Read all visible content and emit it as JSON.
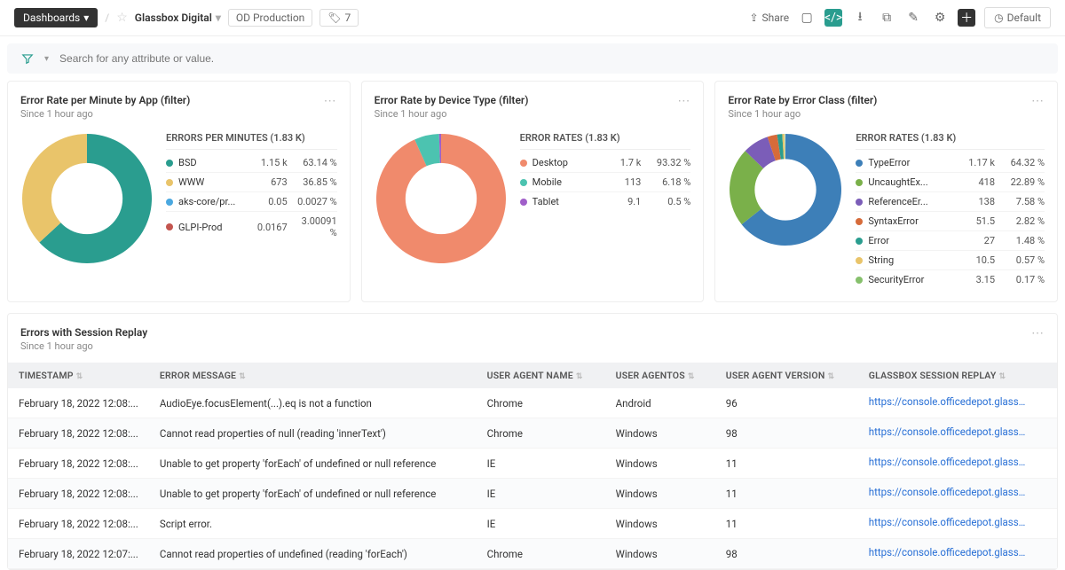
{
  "topbar": {
    "dashboards_label": "Dashboards",
    "title": "Glassbox Digital",
    "environment": "OD Production",
    "tag_count": "7",
    "share_label": "Share",
    "default_label": "Default"
  },
  "filter": {
    "placeholder": "Search for any attribute or value."
  },
  "cards": [
    {
      "id": "app",
      "title": "Error Rate per Minute by App (filter)",
      "subtitle": "Since 1 hour ago",
      "legend_header": "ERRORS PER MINUTES (1.83 K)",
      "items": [
        {
          "name": "BSD",
          "val": "1.15 k",
          "pct": "63.14 %",
          "color": "#2a9d8f"
        },
        {
          "name": "WWW",
          "val": "673",
          "pct": "36.85 %",
          "color": "#e9c46a"
        },
        {
          "name": "aks-core/pr...",
          "val": "0.05",
          "pct": "0.0027 %",
          "color": "#4aa8e0"
        },
        {
          "name": "GLPI-Prod",
          "val": "0.0167",
          "pct": "3.00091 %",
          "color": "#c3554f"
        }
      ],
      "donut": [
        {
          "pct": 63.14,
          "color": "#2a9d8f"
        },
        {
          "pct": 36.85,
          "color": "#e9c46a"
        },
        {
          "pct": 0.01,
          "color": "#4aa8e0"
        }
      ]
    },
    {
      "id": "device",
      "title": "Error Rate by Device Type (filter)",
      "subtitle": "Since 1 hour ago",
      "legend_header": "ERROR RATES (1.83 K)",
      "items": [
        {
          "name": "Desktop",
          "val": "1.7 k",
          "pct": "93.32 %",
          "color": "#f08a6c"
        },
        {
          "name": "Mobile",
          "val": "113",
          "pct": "6.18 %",
          "color": "#4cc3b0"
        },
        {
          "name": "Tablet",
          "val": "9.1",
          "pct": "0.5 %",
          "color": "#a05fc9"
        }
      ],
      "donut": [
        {
          "pct": 93.32,
          "color": "#f08a6c"
        },
        {
          "pct": 6.18,
          "color": "#4cc3b0"
        },
        {
          "pct": 0.5,
          "color": "#a05fc9"
        }
      ]
    },
    {
      "id": "class",
      "title": "Error Rate by Error Class (filter)",
      "subtitle": "Since 1 hour ago",
      "legend_header": "ERROR RATES (1.83 K)",
      "items": [
        {
          "name": "TypeError",
          "val": "1.17 k",
          "pct": "64.32 %",
          "color": "#3d7fb8"
        },
        {
          "name": "UncaughtEx...",
          "val": "418",
          "pct": "22.89 %",
          "color": "#7ab04a"
        },
        {
          "name": "ReferenceEr...",
          "val": "138",
          "pct": "7.58 %",
          "color": "#7b5db8"
        },
        {
          "name": "SyntaxError",
          "val": "51.5",
          "pct": "2.82 %",
          "color": "#d66b3a"
        },
        {
          "name": "Error",
          "val": "27",
          "pct": "1.48 %",
          "color": "#2a9d8f"
        },
        {
          "name": "String",
          "val": "10.5",
          "pct": "0.57 %",
          "color": "#e9c46a"
        },
        {
          "name": "SecurityError",
          "val": "3.15",
          "pct": "0.17 %",
          "color": "#86c06c"
        }
      ],
      "donut": [
        {
          "pct": 64.32,
          "color": "#3d7fb8"
        },
        {
          "pct": 22.89,
          "color": "#7ab04a"
        },
        {
          "pct": 7.58,
          "color": "#7b5db8"
        },
        {
          "pct": 2.82,
          "color": "#d66b3a"
        },
        {
          "pct": 1.48,
          "color": "#2a9d8f"
        },
        {
          "pct": 0.57,
          "color": "#e9c46a"
        },
        {
          "pct": 0.17,
          "color": "#86c06c"
        }
      ]
    }
  ],
  "errors_table": {
    "title": "Errors with Session Replay",
    "subtitle": "Since 1 hour ago",
    "columns": {
      "timestamp": "TIMESTAMP",
      "message": "ERROR MESSAGE",
      "ua_name": "USER AGENT NAME",
      "ua_os": "USER AGENTOS",
      "ua_ver": "USER AGENT VERSION",
      "replay": "GLASSBOX SESSION REPLAY"
    },
    "rows": [
      {
        "ts": "February 18, 2022 12:08:...",
        "msg": "AudioEye.focusElement(...).eq is not a function",
        "ua": "Chrome",
        "os": "Android",
        "ver": "96",
        "link": "https://console.officedepot.glassboxd"
      },
      {
        "ts": "February 18, 2022 12:08:...",
        "msg": "Cannot read properties of null (reading 'innerText')",
        "ua": "Chrome",
        "os": "Windows",
        "ver": "98",
        "link": "https://console.officedepot.glassboxd"
      },
      {
        "ts": "February 18, 2022 12:08:...",
        "msg": "Unable to get property 'forEach' of undefined or null reference",
        "ua": "IE",
        "os": "Windows",
        "ver": "11",
        "link": "https://console.officedepot.glassboxd"
      },
      {
        "ts": "February 18, 2022 12:08:...",
        "msg": "Unable to get property 'forEach' of undefined or null reference",
        "ua": "IE",
        "os": "Windows",
        "ver": "11",
        "link": "https://console.officedepot.glassboxd"
      },
      {
        "ts": "February 18, 2022 12:08:...",
        "msg": "Script error.",
        "ua": "IE",
        "os": "Windows",
        "ver": "11",
        "link": "https://console.officedepot.glassboxd"
      },
      {
        "ts": "February 18, 2022 12:07:...",
        "msg": "Cannot read properties of undefined (reading 'forEach')",
        "ua": "Chrome",
        "os": "Windows",
        "ver": "98",
        "link": "https://console.officedepot.glassboxd"
      }
    ]
  },
  "chart_data": [
    {
      "type": "pie",
      "title": "Error Rate per Minute by App (filter)",
      "categories": [
        "BSD",
        "WWW",
        "aks-core/pr...",
        "GLPI-Prod"
      ],
      "values": [
        1150,
        673,
        0.05,
        0.0167
      ],
      "total": 1830,
      "unit": "errors/min"
    },
    {
      "type": "pie",
      "title": "Error Rate by Device Type (filter)",
      "categories": [
        "Desktop",
        "Mobile",
        "Tablet"
      ],
      "values": [
        1700,
        113,
        9.1
      ],
      "total": 1830
    },
    {
      "type": "pie",
      "title": "Error Rate by Error Class (filter)",
      "categories": [
        "TypeError",
        "UncaughtEx...",
        "ReferenceEr...",
        "SyntaxError",
        "Error",
        "String",
        "SecurityError"
      ],
      "values": [
        1170,
        418,
        138,
        51.5,
        27,
        10.5,
        3.15
      ],
      "total": 1830
    }
  ]
}
